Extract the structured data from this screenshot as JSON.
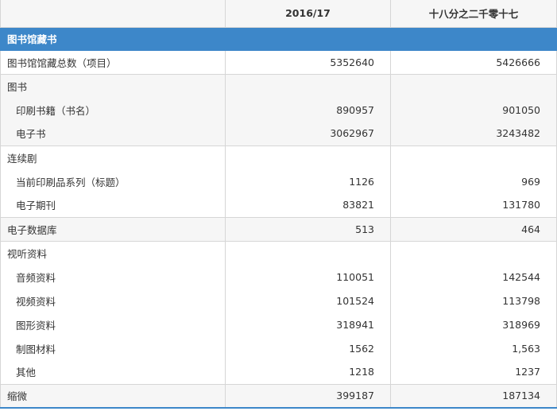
{
  "header": {
    "col1": "",
    "col2": "2016/17",
    "col3": "十八分之二千零十七"
  },
  "section_title": "图书馆藏书",
  "rows": [
    {
      "label": "图书馆馆藏总数（项目）",
      "v1": "5352640",
      "v2": "5426666"
    },
    {
      "label": "图书",
      "v1": "",
      "v2": ""
    },
    {
      "label": "印刷书籍（书名）",
      "v1": "890957",
      "v2": "901050"
    },
    {
      "label": "电子书",
      "v1": "3062967",
      "v2": "3243482"
    },
    {
      "label": "连续剧",
      "v1": "",
      "v2": ""
    },
    {
      "label": "当前印刷品系列（标题）",
      "v1": "1126",
      "v2": "969"
    },
    {
      "label": "电子期刊",
      "v1": "83821",
      "v2": "131780"
    },
    {
      "label": "电子数据库",
      "v1": "513",
      "v2": "464"
    },
    {
      "label": "视听资料",
      "v1": "",
      "v2": ""
    },
    {
      "label": "音频资料",
      "v1": "110051",
      "v2": "142544"
    },
    {
      "label": "视频资料",
      "v1": "101524",
      "v2": "113798"
    },
    {
      "label": "图形资料",
      "v1": "318941",
      "v2": "318969"
    },
    {
      "label": "制图材料",
      "v1": "1562",
      "v2": "1,563"
    },
    {
      "label": "其他",
      "v1": "1218",
      "v2": "1237"
    },
    {
      "label": "缩微",
      "v1": "399187",
      "v2": "187134"
    }
  ]
}
